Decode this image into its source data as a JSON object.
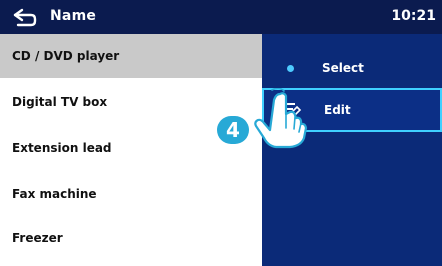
{
  "header": {
    "title": "Name",
    "time": "10:21"
  },
  "list": {
    "items": [
      {
        "label": "CD / DVD player",
        "selected": true
      },
      {
        "label": "Digital TV box",
        "selected": false
      },
      {
        "label": "Extension lead",
        "selected": false
      },
      {
        "label": "Fax machine",
        "selected": false
      },
      {
        "label": "Freezer",
        "selected": false
      }
    ]
  },
  "menu": {
    "items": [
      {
        "label": "Select",
        "icon": "dot-icon"
      },
      {
        "label": "Edit",
        "icon": "edit-icon",
        "active": true
      }
    ]
  },
  "overlay": {
    "step_number": "4",
    "hand": "hand-pointer-icon"
  },
  "colors": {
    "header_bg": "#0b1b4f",
    "menu_bg": "#0b2a78",
    "highlight_border": "#3fd0ff",
    "selected_row": "#c9c9c9",
    "badge": "#27a9d6"
  }
}
